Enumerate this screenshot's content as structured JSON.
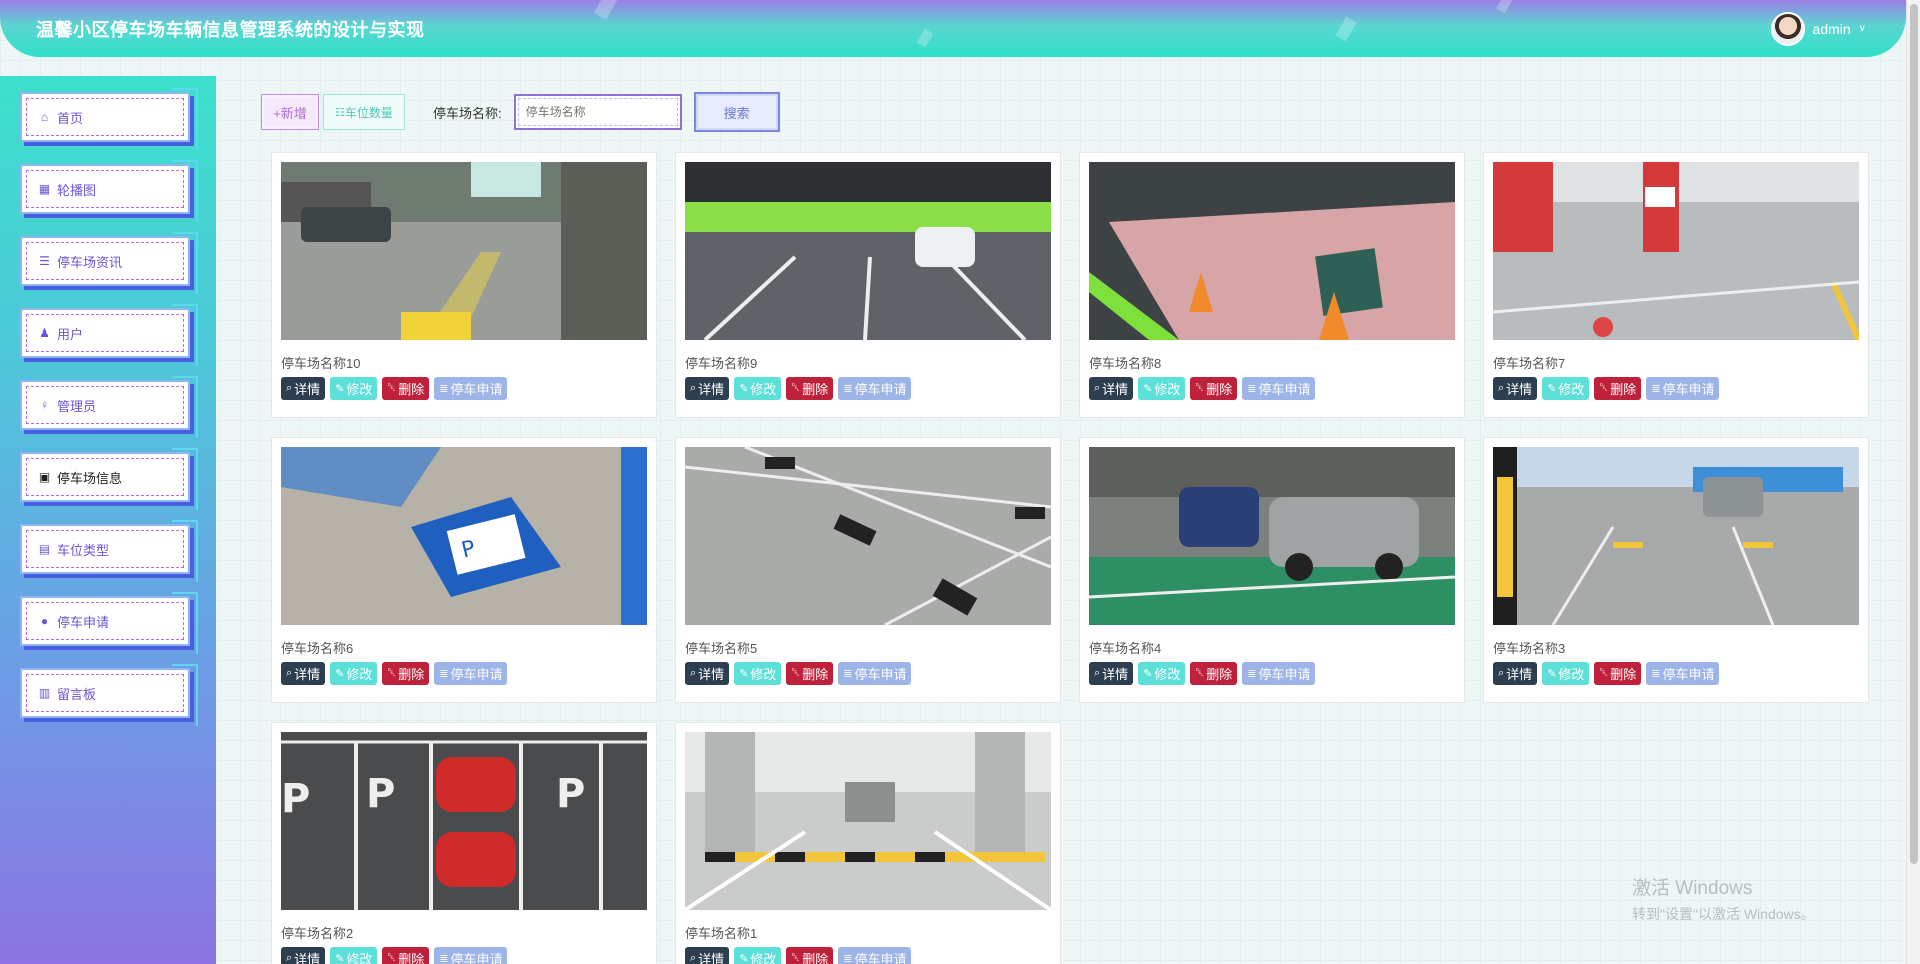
{
  "header": {
    "title": "温馨小区停车场车辆信息管理系统的设计与实现",
    "username": "admin"
  },
  "sidebar": {
    "items": [
      {
        "label": "首页",
        "icon": "home-icon"
      },
      {
        "label": "轮播图",
        "icon": "grid-icon"
      },
      {
        "label": "停车场资讯",
        "icon": "news-icon"
      },
      {
        "label": "用户",
        "icon": "user-icon"
      },
      {
        "label": "管理员",
        "icon": "admin-icon"
      },
      {
        "label": "停车场信息",
        "icon": "parking-icon",
        "active": true
      },
      {
        "label": "车位类型",
        "icon": "type-icon"
      },
      {
        "label": "停车申请",
        "icon": "apply-icon"
      },
      {
        "label": "留言板",
        "icon": "message-icon"
      }
    ]
  },
  "toolbar": {
    "add_label": "+新增",
    "count_label": "车位数量",
    "search_label": "停车场名称:",
    "search_placeholder": "停车场名称",
    "search_button": "搜索"
  },
  "actions": {
    "detail": "详情",
    "edit": "修改",
    "delete": "删除",
    "apply": "停车申请"
  },
  "cards": [
    {
      "name": "停车场名称10",
      "scene": "street"
    },
    {
      "name": "停车场名称9",
      "scene": "garage-green"
    },
    {
      "name": "停车场名称8",
      "scene": "pink-lot"
    },
    {
      "name": "停车场名称7",
      "scene": "red-pillars"
    },
    {
      "name": "停车场名称6",
      "scene": "disabled"
    },
    {
      "name": "停车场名称5",
      "scene": "stoppers"
    },
    {
      "name": "停车场名称4",
      "scene": "cars-green"
    },
    {
      "name": "停车场名称3",
      "scene": "blue-pillars"
    },
    {
      "name": "停车场名称2",
      "scene": "aerial-p"
    },
    {
      "name": "停车场名称1",
      "scene": "bright-garage"
    }
  ],
  "watermark": {
    "line1": "激活 Windows",
    "line2": "转到\"设置\"以激活 Windows。"
  }
}
